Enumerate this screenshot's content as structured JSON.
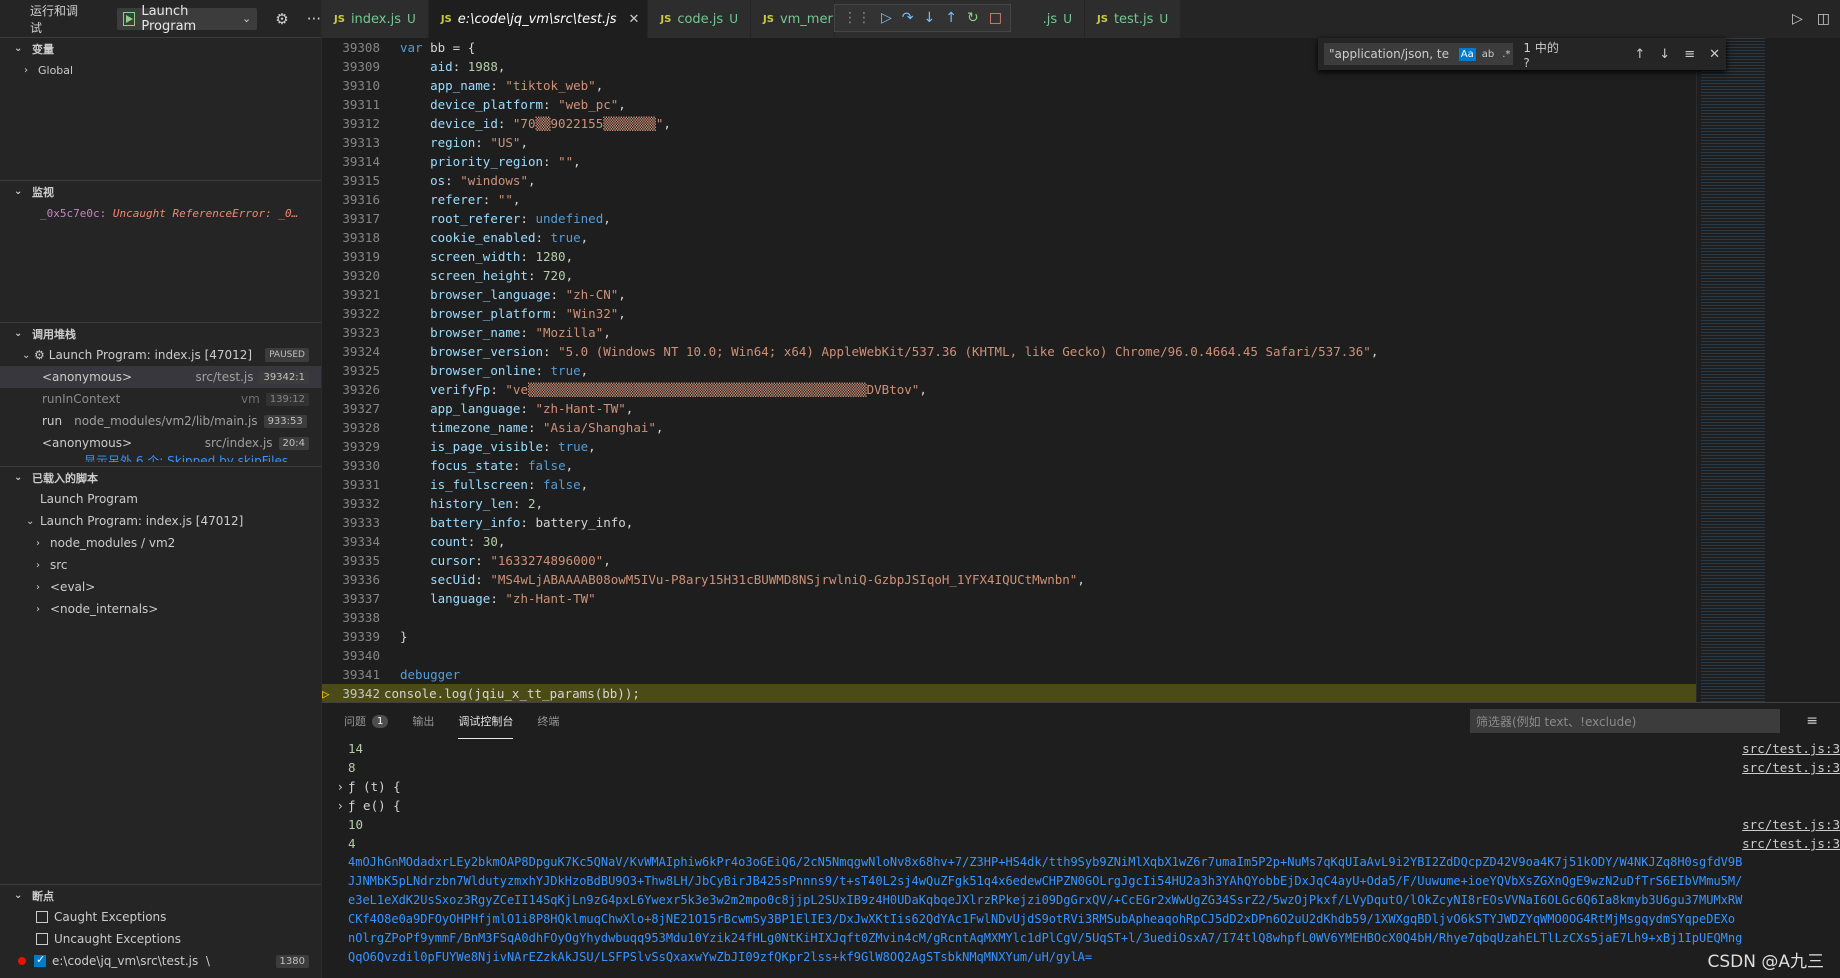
{
  "sidebar": {
    "title": "运行和调试",
    "launch_config": "Launch Program",
    "variables": {
      "header": "变量",
      "items": [
        "Global"
      ]
    },
    "watch": {
      "header": "监视",
      "expr_name": "_0x5c7e0c:",
      "expr_value": "Uncaught ReferenceError: _0…"
    },
    "callstack": {
      "header": "调用堆栈",
      "thread": "Launch Program: index.js [47012]",
      "thread_state": "PAUSED",
      "frames": [
        {
          "fn": "<anonymous>",
          "src": "src/test.js",
          "ln": "39342:1"
        },
        {
          "fn": "runInContext",
          "src": "vm",
          "ln": "139:12"
        },
        {
          "fn": "run",
          "src": "node_modules/vm2/lib/main.js",
          "ln": "933:53"
        },
        {
          "fn": "<anonymous>",
          "src": "src/index.js",
          "ln": "20:4"
        }
      ],
      "skipped": "显示另外 6 个: Skipped by skipFiles"
    },
    "scripts": {
      "header": "已载入的脚本",
      "items": [
        "Launch Program",
        "Launch Program: index.js [47012]",
        "node_modules / vm2",
        "src",
        "<eval>",
        "<node_internals>"
      ]
    },
    "breakpoints": {
      "header": "断点",
      "items": [
        {
          "label": "Caught Exceptions",
          "checked": false
        },
        {
          "label": "Uncaught Exceptions",
          "checked": false
        },
        {
          "label": "e:\\code\\jq_vm\\src\\test.js",
          "suffix": "\\",
          "count": "1380",
          "checked": true
        }
      ]
    }
  },
  "tabs": [
    {
      "name": "index.js",
      "status": "U",
      "active": false
    },
    {
      "name": "e:\\code\\jq_vm\\src\\test.js",
      "status": "",
      "active": true
    },
    {
      "name": "code.js",
      "status": "U",
      "active": false
    },
    {
      "name": "vm_mer",
      "status": "",
      "active": false
    },
    {
      "name": ".js",
      "status": "U",
      "active": false
    },
    {
      "name": "test.js",
      "status": "U",
      "active": false
    }
  ],
  "find": {
    "query": "\"application/json, te",
    "opt_case": "Aa",
    "opt_word": "ab",
    "opt_regex": ".*",
    "result": "1 中的 ?"
  },
  "editor": {
    "lines": [
      {
        "n": "39308",
        "code": "var bb = {"
      },
      {
        "n": "39309",
        "code": "    aid: 1988,"
      },
      {
        "n": "39310",
        "code": "    app_name: \"tiktok_web\","
      },
      {
        "n": "39311",
        "code": "    device_platform: \"web_pc\","
      },
      {
        "n": "39312",
        "code": "    device_id: \"70▒▒9022155▒▒▒▒▒▒▒\","
      },
      {
        "n": "39313",
        "code": "    region: \"US\","
      },
      {
        "n": "39314",
        "code": "    priority_region: \"\","
      },
      {
        "n": "39315",
        "code": "    os: \"windows\","
      },
      {
        "n": "39316",
        "code": "    referer: \"\","
      },
      {
        "n": "39317",
        "code": "    root_referer: undefined,"
      },
      {
        "n": "39318",
        "code": "    cookie_enabled: true,"
      },
      {
        "n": "39319",
        "code": "    screen_width: 1280,"
      },
      {
        "n": "39320",
        "code": "    screen_height: 720,"
      },
      {
        "n": "39321",
        "code": "    browser_language: \"zh-CN\","
      },
      {
        "n": "39322",
        "code": "    browser_platform: \"Win32\","
      },
      {
        "n": "39323",
        "code": "    browser_name: \"Mozilla\","
      },
      {
        "n": "39324",
        "code": "    browser_version: \"5.0 (Windows NT 10.0; Win64; x64) AppleWebKit/537.36 (KHTML, like Gecko) Chrome/96.0.4664.45 Safari/537.36\","
      },
      {
        "n": "39325",
        "code": "    browser_online: true,"
      },
      {
        "n": "39326",
        "code": "    verifyFp: \"ve▒▒▒▒▒▒▒▒▒▒▒▒▒▒▒▒▒▒▒▒▒▒▒▒▒▒▒▒▒▒▒▒▒▒▒▒▒▒▒▒▒▒▒▒▒DVBtov\","
      },
      {
        "n": "39327",
        "code": "    app_language: \"zh-Hant-TW\","
      },
      {
        "n": "39328",
        "code": "    timezone_name: \"Asia/Shanghai\","
      },
      {
        "n": "39329",
        "code": "    is_page_visible: true,"
      },
      {
        "n": "39330",
        "code": "    focus_state: false,"
      },
      {
        "n": "39331",
        "code": "    is_fullscreen: false,"
      },
      {
        "n": "39332",
        "code": "    history_len: 2,"
      },
      {
        "n": "39333",
        "code": "    battery_info: battery_info,"
      },
      {
        "n": "39334",
        "code": "    count: 30,"
      },
      {
        "n": "39335",
        "code": "    cursor: \"1633274896000\","
      },
      {
        "n": "39336",
        "code": "    secUid: \"MS4wLjABAAAAB08owM5IVu-P8ary15H31cBUWMD8NSjrwlniQ-GzbpJSIqoH_1YFX4IQUCtMwnbn\","
      },
      {
        "n": "39337",
        "code": "    language: \"zh-Hant-TW\""
      },
      {
        "n": "39338",
        "code": ""
      },
      {
        "n": "39339",
        "code": "}"
      },
      {
        "n": "39340",
        "code": ""
      },
      {
        "n": "39341",
        "code": "debugger"
      },
      {
        "n": "39342",
        "code": "console.log(jqiu_x_tt_params(bb));",
        "current": true
      }
    ]
  },
  "panel": {
    "tabs": [
      {
        "label": "问题",
        "badge": "1"
      },
      {
        "label": "输出"
      },
      {
        "label": "调试控制台",
        "active": true
      },
      {
        "label": "终端"
      }
    ],
    "filter_placeholder": "筛选器(例如 text、!exclude)",
    "console": [
      {
        "text": "14",
        "src": "src/test.js:3"
      },
      {
        "text": "8",
        "src": "src/test.js:3"
      },
      {
        "text": "ƒ (t) {",
        "expand": true
      },
      {
        "text": "ƒ e() {",
        "expand": true
      },
      {
        "text": "10",
        "src": "src/test.js:3"
      },
      {
        "text": "4",
        "src": "src/test.js:3"
      }
    ],
    "long_output": [
      "4mOJhGnMOdadxrLEy2bkmOAP8DpguK7Kc5QNaV/KvWMAIphiw6kPr4o3oGEiQ6/2cN5NmqgwNloNv8x68hv+7/Z3HP+HS4dk/tth9Syb9ZNiMlXqbX1wZ6r7umaIm5P2p+NuMs7qKqUIaAvL9i2YBI2ZdDQcpZD42V9oa4K7j51kODY/W4NKJZq8H0sgfdV9B",
      "JJNMbK5pLNdrzbn7WldutyzmxhYJDkHzoBdBU9O3+Thw8LH/JbCyBirJB425sPnnns9/t+sT40L2sj4wQuZFgk51q4x6edewCHPZN0GOLrgJgcIi54HU2a3h3YAhQYobbEjDxJqC4ayU+Oda5/F/Uuwume+ioeYQVbXsZGXnQgE9wzN2uDfTrS6EIbVMmu5M/",
      "e3eL1eXdK2UsSxoz3RgyZCeII14SqKjLn9zG4pxL6Ywexr5k3e3w2m2mpo0c8jjpL2SUxIB9z4H0UDaKqbqeJXlrzRPkejzi09DgGrxQV/+CcEGr2xWwUgZG34SsrZ2/5wzOjPkxf/LVyDqutO/lOkZcyNI8rEOsVVNaI6OLGc6Q6Ia8kmyb3U6gu37MUMxRW",
      "CKf4O8e0a9DFOyOHPHfjmlO1i8P8HQklmuqChwXlo+8jNE21O15rBcwmSy3BP1ElIE3/DxJwXKtIis62QdYAc1FwlNDvUjdS9otRVi3RMSubApheaqohRpCJ5dD2xDPn6O2uU2dKhdb59/1XWXgqBDljvO6kSTYJWDZYqWMO0OG4RtMjMsgqydmSYqpeDEXo",
      "nOlrgZPoPf9ymmF/BnM3FSqA0dhFOyOgYhydwbuqq953Mdu10Yzik24fHLg0NtKiHIXJqft0ZMvin4cM/gRcntAqMXMYlc1dPlCgV/5UqST+l/3uediOsxA7/I74tlQ8whpfL0WV6YMEHBOcX0Q4bH/Rhye7qbqUzahELTlLzCXs5jaE7Lh9+xBj1IpUEQMng",
      "QqO6Qvzdil0pFUYWe8NjivNArEZzkAkJSU/LSFPSlvSsQxaxwYwZbJI09zfQKpr2lss+kf9GlW8OQ2AgSTsbkNMqMNXYum/uH/gylA="
    ]
  },
  "watermark": "CSDN @A九三",
  "colors": {
    "accent": "#007acc",
    "current_line": "#4b4b18",
    "string": "#ce9178",
    "keyword": "#569cd6"
  }
}
